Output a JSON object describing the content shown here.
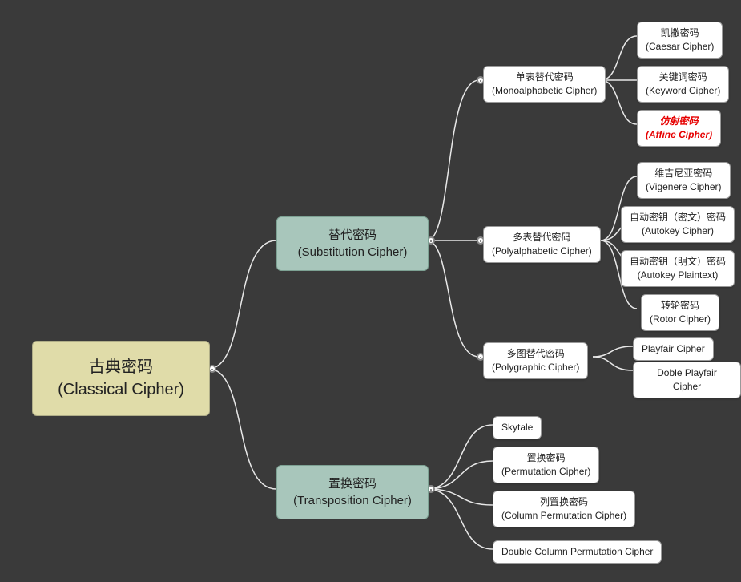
{
  "root": {
    "cn": "古典密码",
    "en": "(Classical Cipher)"
  },
  "branches": [
    {
      "cn": "替代密码",
      "en": "(Substitution Cipher)"
    },
    {
      "cn": "置换密码",
      "en": "(Transposition Cipher)"
    }
  ],
  "substitution_sub": [
    {
      "cn": "单表替代密码",
      "en": "(Monoalphabetic Cipher)"
    },
    {
      "cn": "多表替代密码",
      "en": "(Polyalphabetic Cipher)"
    },
    {
      "cn": "多图替代密码",
      "en": "(Polygraphic Cipher)"
    }
  ],
  "mono_leaves": [
    {
      "cn": "凯撒密码",
      "en": "(Caesar Cipher)"
    },
    {
      "cn": "关键词密码",
      "en": "(Keyword Cipher)"
    },
    {
      "cn": "仿射密码",
      "en": "(Affine Cipher)",
      "highlight": true
    }
  ],
  "poly_leaves": [
    {
      "cn": "维吉尼亚密码",
      "en": "(Vigenere Cipher)"
    },
    {
      "cn": "自动密钥（密文）密码",
      "en": "(Autokey Cipher)"
    },
    {
      "cn": "自动密钥（明文）密码",
      "en": "(Autokey Plaintext)"
    },
    {
      "cn": "转轮密码",
      "en": "(Rotor Cipher)"
    }
  ],
  "graphic_leaves": [
    {
      "single": "Playfair Cipher"
    },
    {
      "single": "Doble Playfair Cipher"
    }
  ],
  "trans_leaves": [
    {
      "single": "Skytale"
    },
    {
      "cn": "置换密码",
      "en": "(Permutation Cipher)"
    },
    {
      "cn": "列置换密码",
      "en": "(Column Permutation Cipher)"
    },
    {
      "single": "Double Column Permutation Cipher"
    }
  ]
}
